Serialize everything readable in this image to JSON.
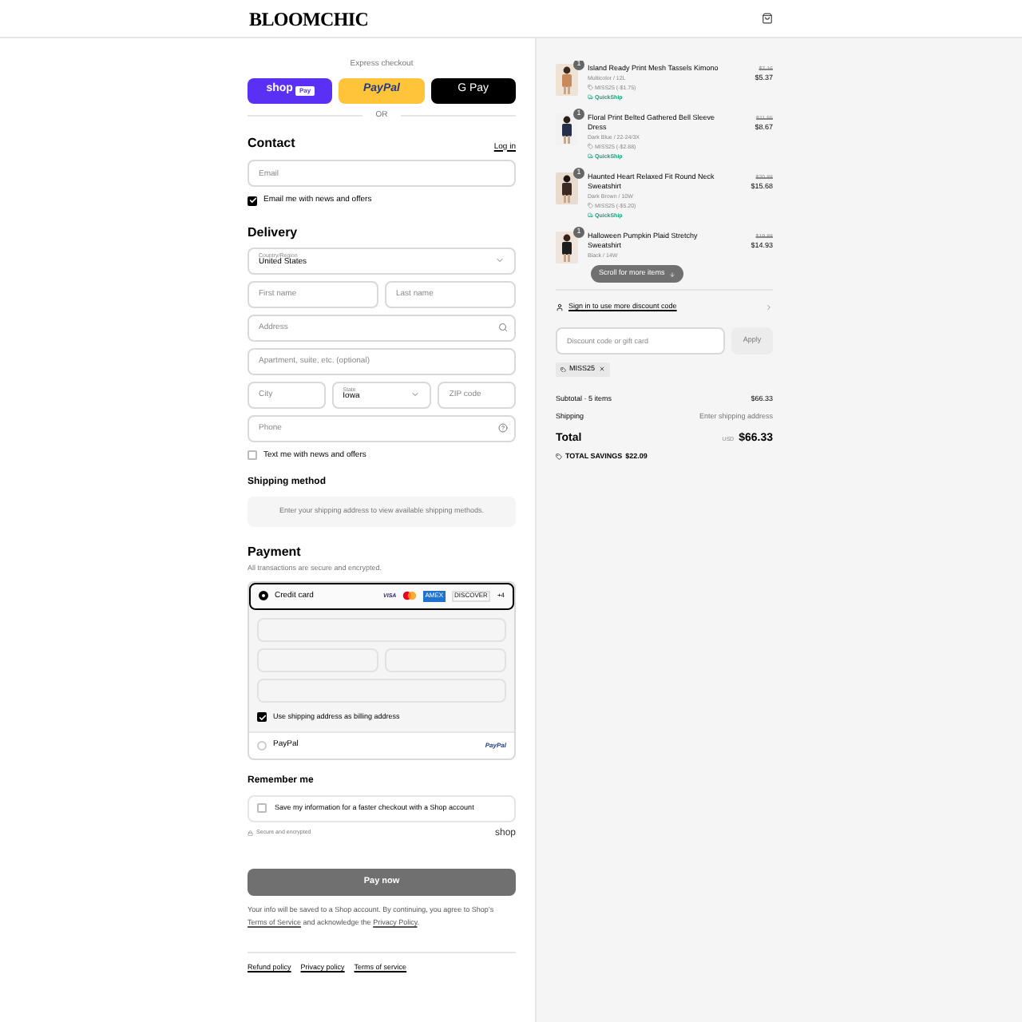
{
  "header": {
    "logo": "BLOOMCHIC"
  },
  "express": {
    "label": "Express checkout",
    "buttons": [
      {
        "kind": "shop",
        "text": "shop",
        "badge": "Pay"
      },
      {
        "kind": "paypal",
        "text": "PayPal"
      },
      {
        "kind": "gpay",
        "text": "G Pay"
      }
    ],
    "divider": "OR"
  },
  "contact": {
    "title": "Contact",
    "link": "Log in",
    "email": {
      "placeholder": "Email"
    },
    "news": {
      "label": "Email me with news and offers",
      "checked": true
    }
  },
  "delivery": {
    "title": "Delivery",
    "country": {
      "label": "Country/Region",
      "value": "United States"
    },
    "first_name": {
      "placeholder": "First name"
    },
    "last_name": {
      "placeholder": "Last name"
    },
    "address": {
      "placeholder": "Address"
    },
    "apartment": {
      "placeholder": "Apartment, suite, etc. (optional)"
    },
    "city": {
      "placeholder": "City"
    },
    "state": {
      "label": "State",
      "value": "Iowa"
    },
    "zip": {
      "placeholder": "ZIP code"
    },
    "phone": {
      "placeholder": "Phone"
    },
    "text_me": {
      "label": "Text me with news and offers",
      "checked": false
    }
  },
  "shipping_method": {
    "title": "Shipping method",
    "message": "Enter your shipping address to view available shipping methods."
  },
  "payment": {
    "title": "Payment",
    "subtitle": "All transactions are secure and encrypted.",
    "options": [
      {
        "kind": "card",
        "label": "Credit card",
        "selected": true,
        "logos": [
          "VISA",
          "AMEX",
          "DISCOVER",
          "+4"
        ]
      },
      {
        "kind": "paypal",
        "label": "PayPal",
        "selected": false,
        "logo": "PayPal"
      }
    ],
    "billing": {
      "label": "Use shipping address as billing address",
      "checked": true
    }
  },
  "remember": {
    "title": "Remember me",
    "save": {
      "label": "Save my information for a faster checkout with a Shop account",
      "checked": false
    },
    "secure": "Secure and encrypted",
    "shop_logo": "shop"
  },
  "pay_button": "Pay now",
  "legal": "Your info will be saved to a Shop account. By continuing, you agree to Shop’s",
  "legal_links": [
    "Terms of Service",
    "Privacy Policy"
  ],
  "legal_mid": "and acknowledge the",
  "legal_end": ".",
  "footer_links": [
    "Refund policy",
    "Privacy policy",
    "Terms of service"
  ],
  "cart": {
    "items": [
      {
        "qty": "1",
        "name": "Island Ready Print Mesh Tassels Kimono",
        "variant": "Multicolor / 12L",
        "discount": "MISS25 (-$1.75)",
        "tag": "QuickShip",
        "old": "$7.16",
        "price": "$5.37"
      },
      {
        "qty": "1",
        "name": "Floral Print Belted Gathered Bell Sleeve Dress",
        "variant": "Dark Blue / 22-24/3X",
        "discount": "MISS25 (-$2.88)",
        "tag": "QuickShip",
        "old": "$11.55",
        "price": "$8.67"
      },
      {
        "qty": "1",
        "name": "Haunted Heart Relaxed Fit Round Neck Sweatshirt",
        "variant": "Dark Brown / 10W",
        "discount": "MISS25 (-$5.20)",
        "tag": "QuickShip",
        "old": "$20.88",
        "price": "$15.68"
      },
      {
        "qty": "1",
        "name": "Halloween Pumpkin Plaid Stretchy Sweatshirt",
        "variant": "Black / 14W",
        "old": "$19.88",
        "price": "$14.93"
      }
    ],
    "scroll_hint": "Scroll for more items",
    "sign_in": "Sign in to use more discount code",
    "discount": {
      "placeholder": "Discount code or gift card",
      "button": "Apply",
      "code": "MISS25"
    },
    "subtotal": {
      "label": "Subtotal · 5 items",
      "value": "$66.33"
    },
    "shipping": {
      "label": "Shipping",
      "value": "Enter shipping address"
    },
    "total": {
      "label": "Total",
      "currency": "USD",
      "value": "$66.33"
    },
    "savings": {
      "label": "TOTAL SAVINGS",
      "value": "$22.09"
    }
  }
}
